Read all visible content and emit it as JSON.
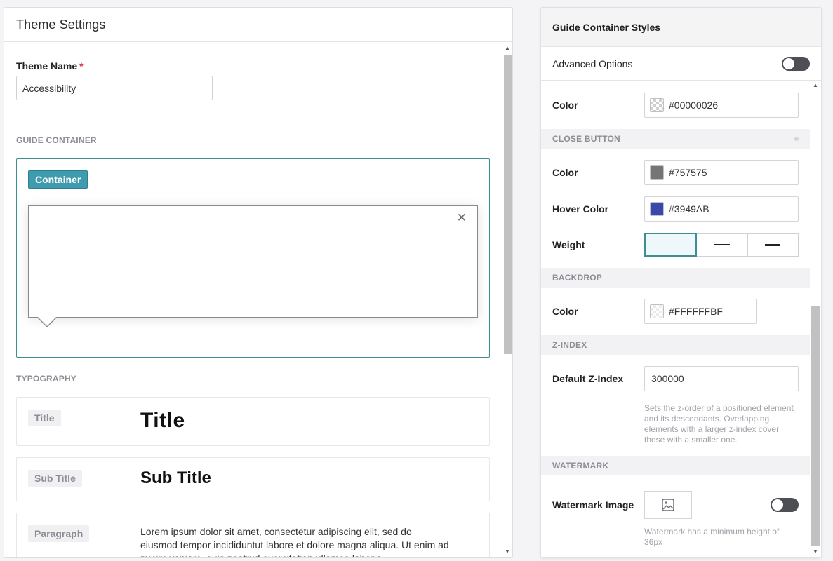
{
  "left": {
    "title": "Theme Settings",
    "theme_name": {
      "label": "Theme Name",
      "required_mark": "*",
      "value": "Accessibility"
    },
    "guide_container": {
      "section_label": "GUIDE CONTAINER",
      "badge": "Container",
      "close_glyph": "✕"
    },
    "typography": {
      "section_label": "TYPOGRAPHY",
      "items": [
        {
          "tag": "Title",
          "sample": "Title"
        },
        {
          "tag": "Sub Title",
          "sample": "Sub Title"
        },
        {
          "tag": "Paragraph",
          "sample": "Lorem ipsum dolor sit amet, consectetur adipiscing elit, sed do eiusmod tempor incididuntut labore et dolore magna aliqua. Ut enim ad minim veniam, quis nostrud exercitation ullamco laboris"
        }
      ]
    }
  },
  "right": {
    "title": "Guide Container Styles",
    "advanced_options": {
      "label": "Advanced Options",
      "enabled": false
    },
    "container_color": {
      "label": "Color",
      "value": "#00000026"
    },
    "close_button": {
      "section_label": "CLOSE BUTTON",
      "color": {
        "label": "Color",
        "value": "#757575",
        "swatch": "#757575"
      },
      "hover_color": {
        "label": "Hover Color",
        "value": "#3949AB",
        "swatch": "#3949AB"
      },
      "weight": {
        "label": "Weight",
        "options": [
          "thin",
          "medium",
          "bold"
        ],
        "selected": "thin"
      }
    },
    "backdrop": {
      "section_label": "BACKDROP",
      "color": {
        "label": "Color",
        "value": "#FFFFFFBF"
      }
    },
    "z_index": {
      "section_label": "Z-INDEX",
      "default": {
        "label": "Default Z-Index",
        "value": "300000"
      },
      "help": "Sets the z-order of a positioned element and its descendants. Overlapping elements with a larger z-index cover those with a smaller one."
    },
    "watermark": {
      "section_label": "WATERMARK",
      "image": {
        "label": "Watermark Image",
        "enabled": false,
        "icon": "image-icon"
      },
      "help": "Watermark has a minimum height of 36px"
    }
  },
  "colors": {
    "accent": "#3D8F94",
    "badge": "#3E9CAE",
    "required": "#D9354B"
  }
}
